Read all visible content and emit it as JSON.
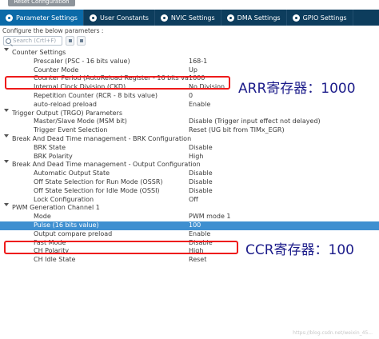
{
  "reset_button": "Reset Configuration",
  "tabs": [
    {
      "label": "Parameter Settings"
    },
    {
      "label": "User Constants"
    },
    {
      "label": "NVIC Settings"
    },
    {
      "label": "DMA Settings"
    },
    {
      "label": "GPIO Settings"
    }
  ],
  "configure_label": "Configure the below parameters :",
  "search": {
    "placeholder": "Search (Crtl+F)"
  },
  "groups": [
    {
      "title": "Counter Settings",
      "items": [
        {
          "name": "Prescaler (PSC - 16 bits value)",
          "value": "168-1"
        },
        {
          "name": "Counter Mode",
          "value": "Up"
        },
        {
          "name": "Counter Period (AutoReload Register - 16 bits value )",
          "value": "1000"
        },
        {
          "name": "Internal Clock Division (CKD)",
          "value": "No Division"
        },
        {
          "name": "Repetition Counter (RCR - 8 bits value)",
          "value": "0"
        },
        {
          "name": "auto-reload preload",
          "value": "Enable"
        }
      ]
    },
    {
      "title": "Trigger Output (TRGO) Parameters",
      "items": [
        {
          "name": "Master/Slave Mode (MSM bit)",
          "value": "Disable (Trigger input effect not delayed)"
        },
        {
          "name": "Trigger Event Selection",
          "value": "Reset (UG bit from TIMx_EGR)"
        }
      ]
    },
    {
      "title": "Break And Dead Time management - BRK Configuration",
      "items": [
        {
          "name": "BRK State",
          "value": "Disable"
        },
        {
          "name": "BRK Polarity",
          "value": "High"
        }
      ]
    },
    {
      "title": "Break And Dead Time management - Output Configuration",
      "items": [
        {
          "name": "Automatic Output State",
          "value": "Disable"
        },
        {
          "name": "Off State Selection for Run Mode (OSSR)",
          "value": "Disable"
        },
        {
          "name": "Off State Selection for Idle Mode (OSSI)",
          "value": "Disable"
        },
        {
          "name": "Lock Configuration",
          "value": "Off"
        }
      ]
    },
    {
      "title": "PWM Generation Channel 1",
      "items": [
        {
          "name": "Mode",
          "value": "PWM mode 1"
        },
        {
          "name": "Pulse (16 bits value)",
          "value": "100"
        },
        {
          "name": "Output compare preload",
          "value": "Enable"
        },
        {
          "name": "Fast Mode",
          "value": "Disable"
        },
        {
          "name": "CH Polarity",
          "value": "High"
        },
        {
          "name": "CH Idle State",
          "value": "Reset"
        }
      ]
    }
  ],
  "annotations": {
    "arr": "ARR寄存器：1000",
    "ccr": "CCR寄存器：100"
  },
  "watermark": "https://blog.csdn.net/weixin_45..."
}
